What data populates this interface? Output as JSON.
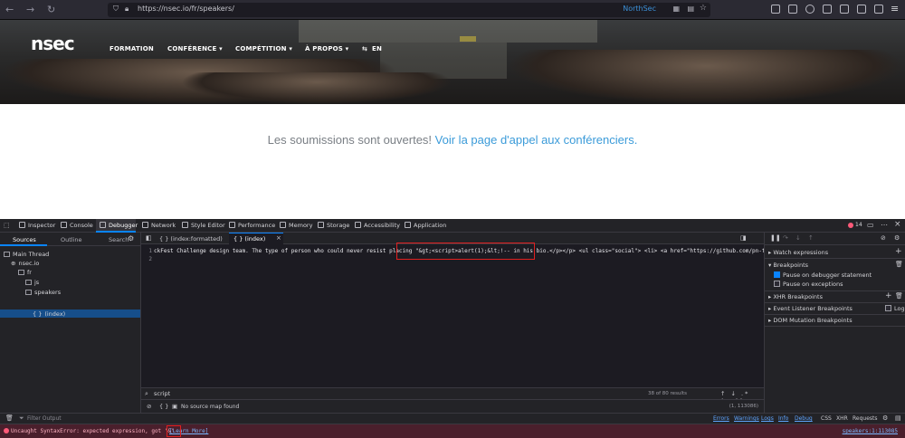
{
  "browser": {
    "url": "https://nsec.io/fr/speakers/",
    "badge": "NorthSec"
  },
  "site": {
    "logo": "nsec",
    "menu": [
      "FORMATION",
      "CONFÉRENCE ▾",
      "COMPÉTITION ▾",
      "À PROPOS ▾",
      "EN"
    ],
    "callout_text": "Les soumissions sont ouvertes!",
    "callout_link": "Voir la page d'appel aux conférenciers."
  },
  "devtools": {
    "tabs": [
      "Inspector",
      "Console",
      "Debugger",
      "Network",
      "Style Editor",
      "Performance",
      "Memory",
      "Storage",
      "Accessibility",
      "Application"
    ],
    "selected_tab": "Debugger",
    "error_count": "14",
    "left_panel": {
      "tabs": [
        "Sources",
        "Outline",
        "Search"
      ],
      "tree": [
        "Main Thread",
        "nsec.io",
        "fr",
        "js",
        "speakers",
        "(index)"
      ]
    },
    "editor_tabs": [
      "{ } (index:formatted)",
      "{ } (index)"
    ],
    "code": {
      "line1": "ckFest Challenge design team. The type of person who could never resist placing \"&gt;<script>alert(1);&lt;!-- in his bio.</p></p> <ul class=\"social\"> <li> <a href=\"https://github.com/pn-tester\"",
      "line_numbers": [
        "1",
        "2"
      ]
    },
    "search": {
      "query": "script",
      "results": "38 of 80 results",
      "options": "↑ ↓ .* Aa \"\" ×"
    },
    "footer": {
      "source_map": "No source map found",
      "position": "(1, 113086)"
    },
    "right_panel": {
      "watch": "Watch expressions",
      "breakpoints": "Breakpoints",
      "pause_debugger": "Pause on debugger statement",
      "pause_exceptions": "Pause on exceptions",
      "xhr": "XHR Breakpoints",
      "event": "Event Listener Breakpoints",
      "log": "Log",
      "dom": "DOM Mutation Breakpoints"
    },
    "console": {
      "filter_placeholder": "Filter Output",
      "filters": [
        "Errors",
        "Warnings",
        "Logs",
        "Info",
        "Debug"
      ],
      "filters2": [
        "CSS",
        "XHR",
        "Requests"
      ],
      "error": "Uncaught SyntaxError: expected expression, got '&'",
      "learn_more": "[Learn More]",
      "location": "speakers:1:113085"
    }
  }
}
